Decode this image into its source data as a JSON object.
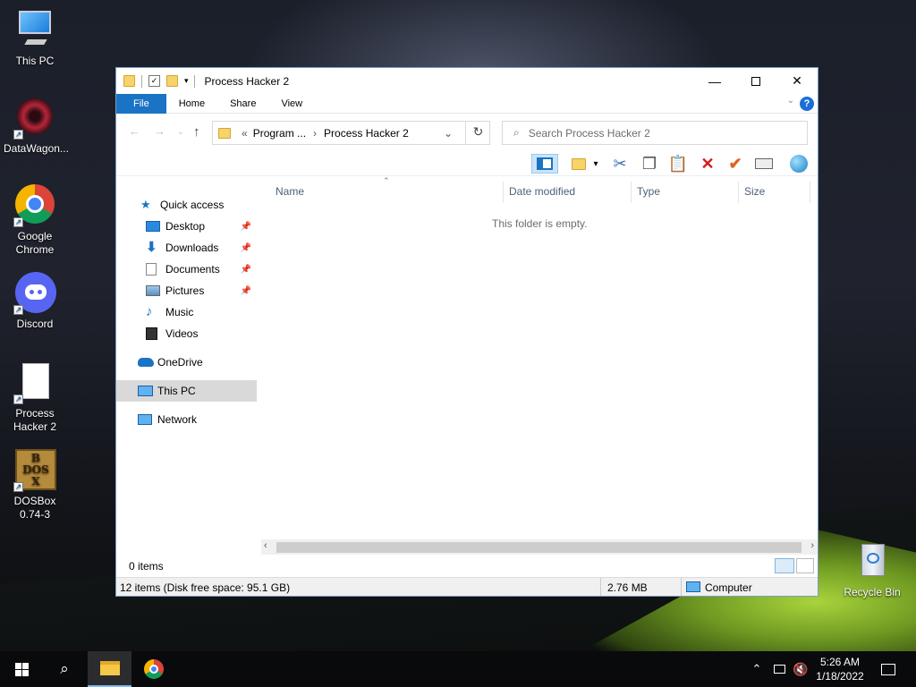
{
  "desktop": {
    "icons": [
      {
        "label": "This PC"
      },
      {
        "label": "DataWagon..."
      },
      {
        "label": "Google Chrome"
      },
      {
        "label": "Discord"
      },
      {
        "label": "Process Hacker 2"
      },
      {
        "label": "DOSBox 0.74-3"
      },
      {
        "label": "Recycle Bin"
      }
    ]
  },
  "window": {
    "title": "Process Hacker 2",
    "ribbon_tabs": [
      "File",
      "Home",
      "Share",
      "View"
    ],
    "address": {
      "crumbs": [
        "«",
        "Program ...",
        "›",
        "Process Hacker 2"
      ]
    },
    "search_placeholder": "Search Process Hacker 2",
    "nav": {
      "quick_access": "Quick access",
      "items": [
        "Desktop",
        "Downloads",
        "Documents",
        "Pictures",
        "Music",
        "Videos"
      ],
      "onedrive": "OneDrive",
      "this_pc": "This PC",
      "network": "Network"
    },
    "columns": [
      "Name",
      "Date modified",
      "Type",
      "Size"
    ],
    "empty_message": "This folder is empty.",
    "status_items": "0 items",
    "details_bar": {
      "left": "12 items (Disk free space: 95.1 GB)",
      "size": "2.76 MB",
      "location": "Computer"
    }
  },
  "taskbar": {
    "time": "5:26 AM",
    "date": "1/18/2022"
  },
  "colors": {
    "accent": "#1a73c4",
    "selection": "#d9d9d9"
  }
}
